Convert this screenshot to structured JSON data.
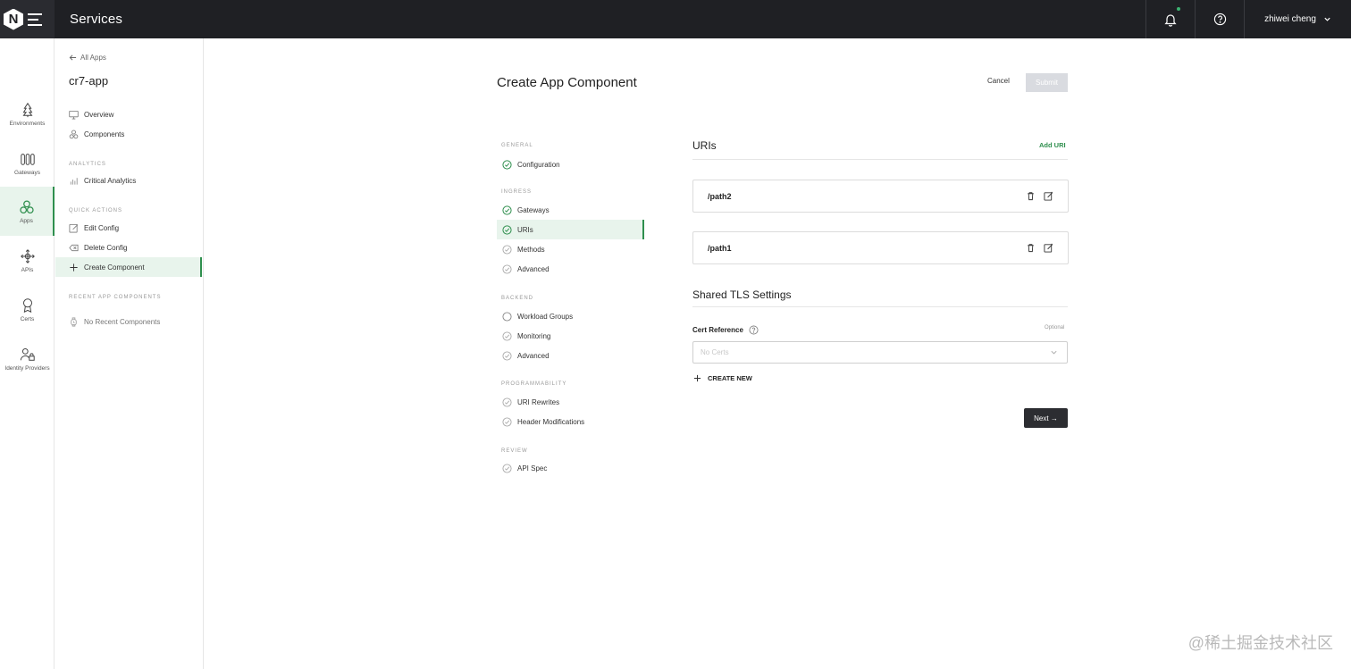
{
  "topbar": {
    "logo_letter": "N",
    "title": "Services",
    "user_name": "zhiwei cheng"
  },
  "rail": {
    "items": [
      {
        "label": "Environments",
        "icon": "tree-icon"
      },
      {
        "label": "Gateways",
        "icon": "gateways-icon"
      },
      {
        "label": "Apps",
        "icon": "apps-icon",
        "active": true
      },
      {
        "label": "APIs",
        "icon": "apis-icon"
      },
      {
        "label": "Certs",
        "icon": "certs-icon"
      },
      {
        "label": "Identity Providers",
        "icon": "identity-icon"
      }
    ]
  },
  "sidebar": {
    "back_label": "All Apps",
    "app_name": "cr7-app",
    "items": [
      {
        "label": "Overview",
        "icon": "monitor-icon"
      },
      {
        "label": "Components",
        "icon": "components-icon"
      }
    ],
    "analytics_section": "ANALYTICS",
    "analytics_items": [
      {
        "label": "Critical Analytics",
        "icon": "bar-chart-icon"
      }
    ],
    "quick_actions_section": "QUICK ACTIONS",
    "quick_actions": [
      {
        "label": "Edit Config",
        "icon": "edit-icon"
      },
      {
        "label": "Delete Config",
        "icon": "delete-icon"
      },
      {
        "label": "Create Component",
        "icon": "plus-icon",
        "active": true
      }
    ],
    "recent_section": "RECENT APP COMPONENTS",
    "recent_empty": "No Recent Components"
  },
  "main": {
    "title": "Create App Component",
    "cancel_label": "Cancel",
    "submit_label": "Submit",
    "steps": {
      "general_section": "GENERAL",
      "configuration": "Configuration",
      "ingress_section": "INGRESS",
      "gateways": "Gateways",
      "uris": "URIs",
      "methods": "Methods",
      "advanced_ingress": "Advanced",
      "backend_section": "BACKEND",
      "workload_groups": "Workload Groups",
      "monitoring": "Monitoring",
      "advanced_backend": "Advanced",
      "programmability_section": "PROGRAMMABILITY",
      "uri_rewrites": "URI Rewrites",
      "header_modifications": "Header Modifications",
      "review_section": "REVIEW",
      "api_spec": "API Spec"
    },
    "uris_title": "URIs",
    "add_uri_label": "Add URI",
    "uris": [
      "/path2",
      "/path1"
    ],
    "tls_title": "Shared TLS Settings",
    "cert_reference_label": "Cert Reference",
    "optional_label": "Optional",
    "cert_placeholder": "No Certs",
    "create_new_label": "CREATE NEW",
    "next_label": "Next →"
  },
  "watermark": "@稀土掘金技术社区",
  "colors": {
    "accent": "#2f8f4e",
    "active_bg": "#e8f4ec",
    "topbar_bg": "#1f2024"
  }
}
